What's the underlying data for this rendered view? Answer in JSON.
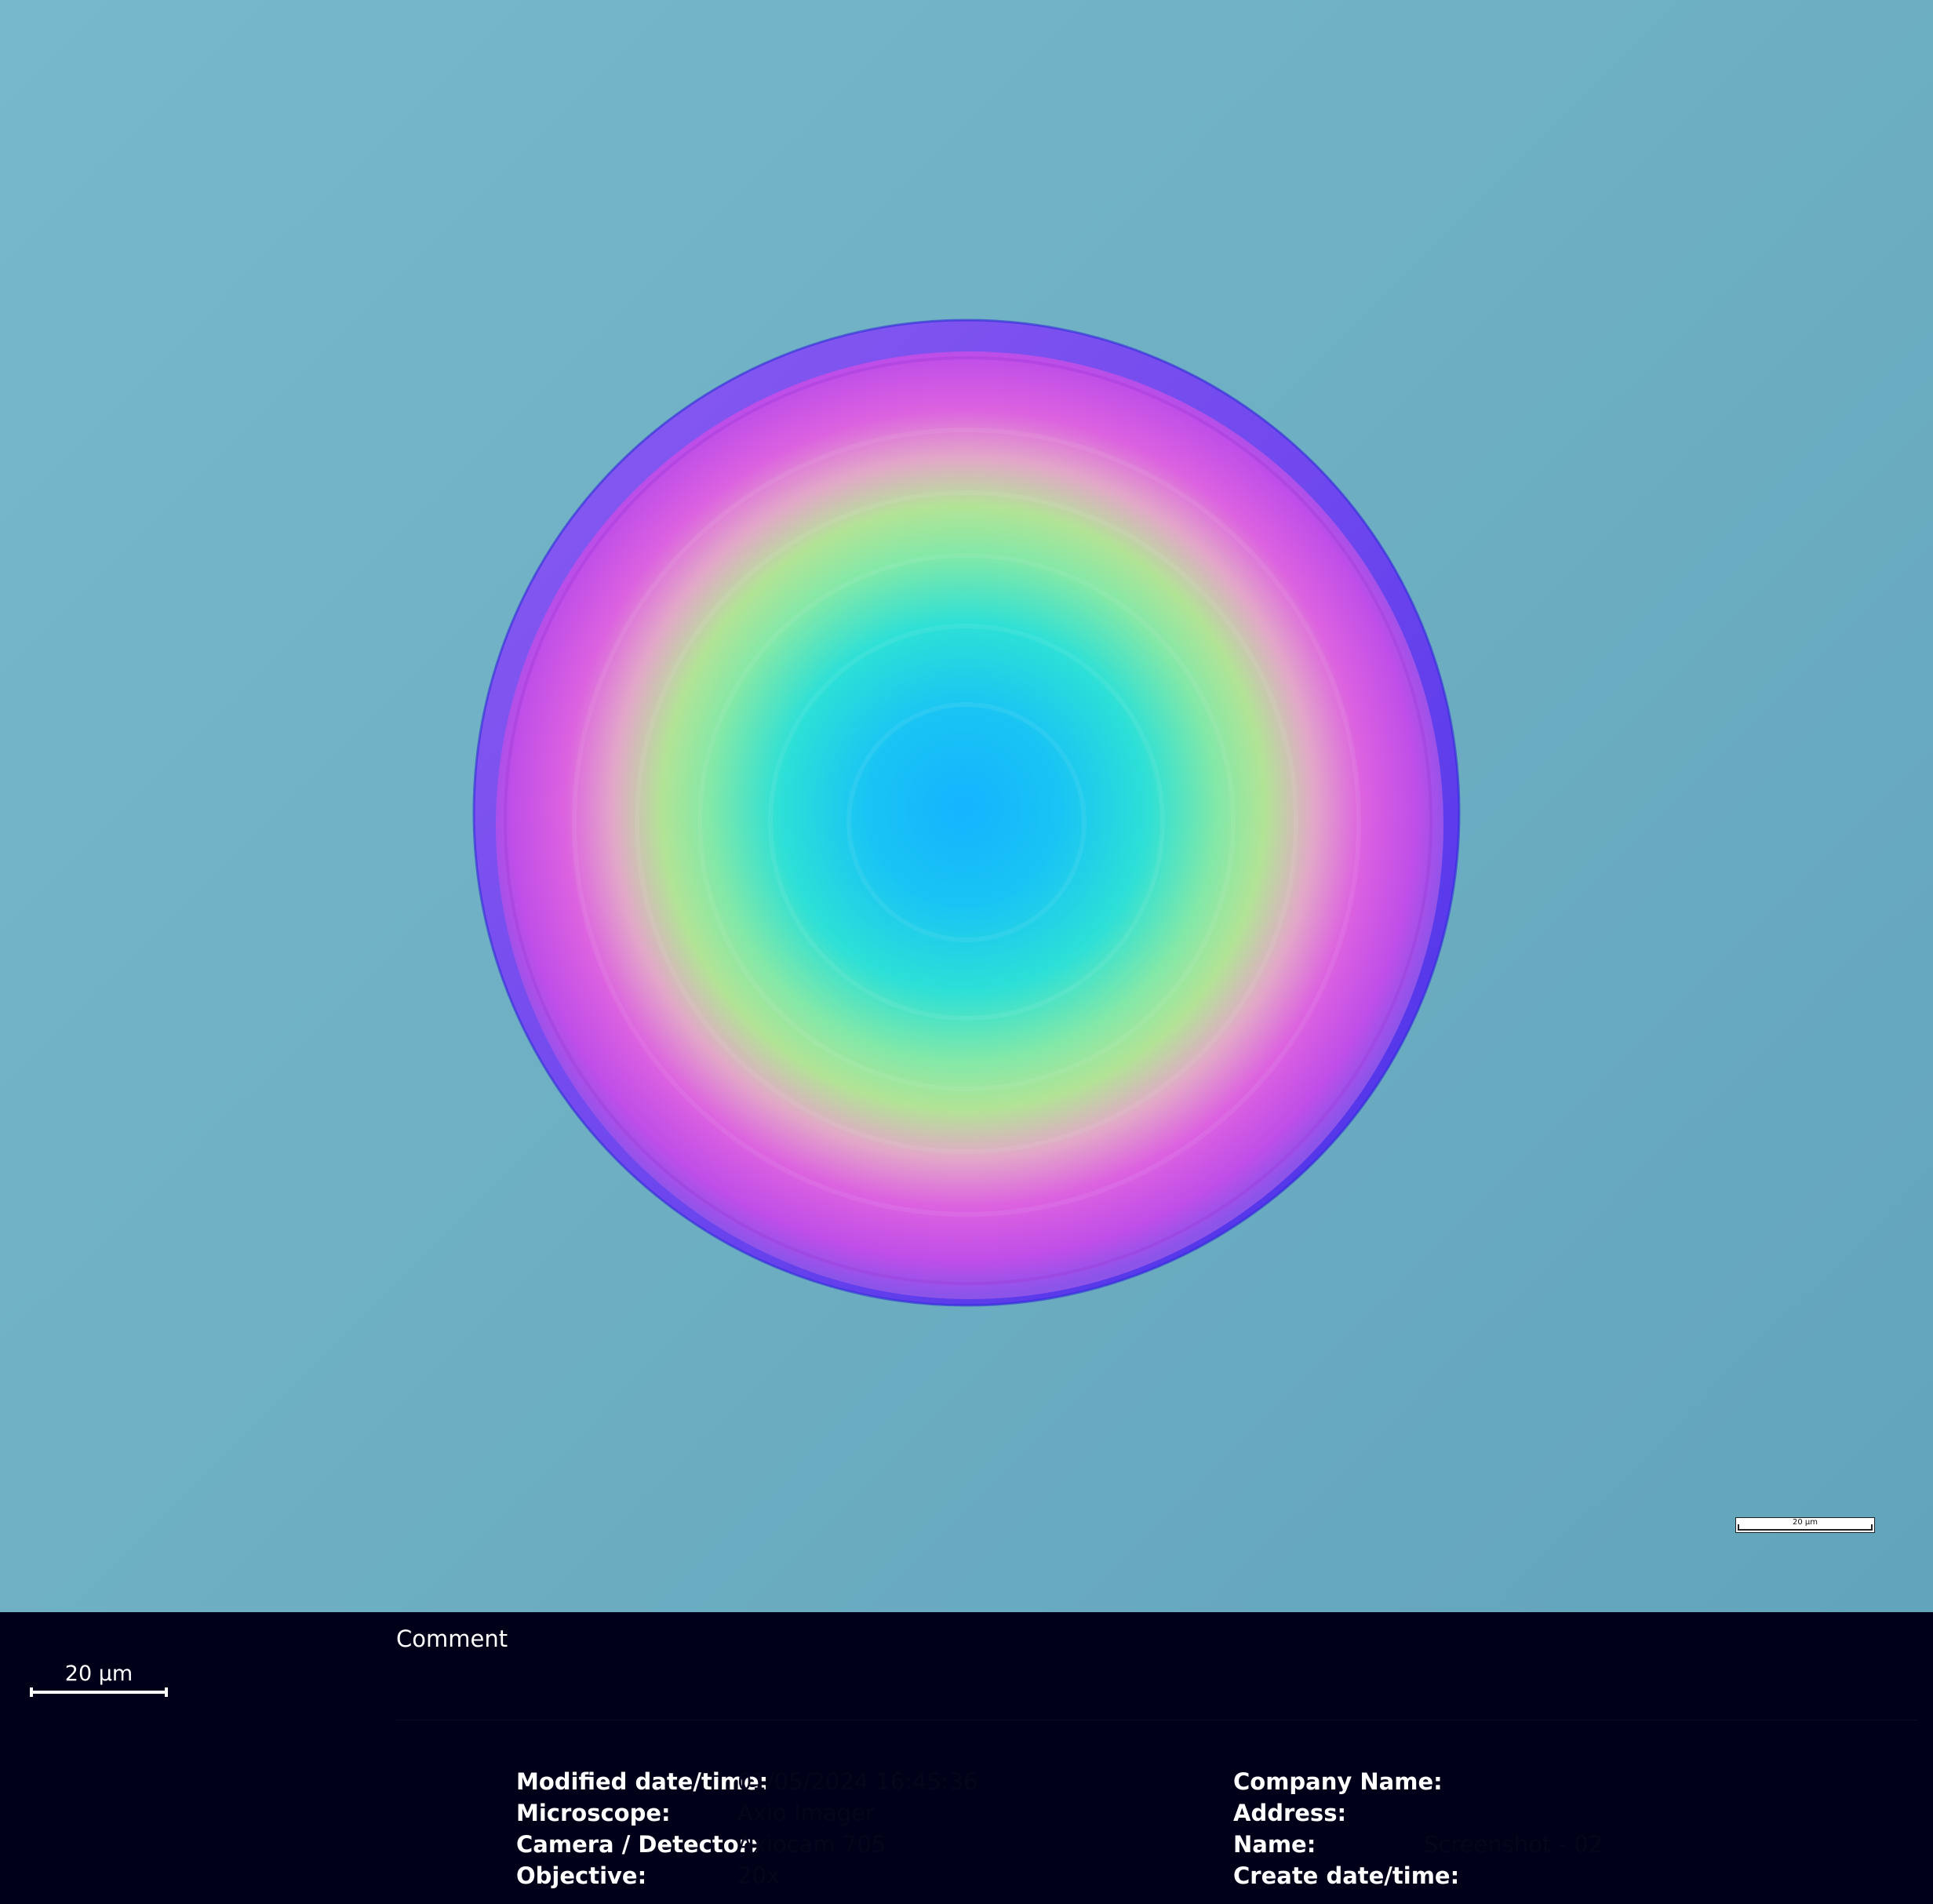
{
  "image": {
    "subject": "interference-colour-dome",
    "colors": {
      "background": "#6fb0c4",
      "center": "#14b4ff",
      "mid": "#8ee8a0",
      "outer": "#c055e8",
      "rim": "#6e4ff0"
    }
  },
  "inset_scalebar": {
    "label": "20 µm"
  },
  "info_panel": {
    "scalebar_label": "20 µm",
    "comment_label": "Comment",
    "left_fields": [
      {
        "label": "Modified date/time:",
        "value": "01/05/2024 16:45:36"
      },
      {
        "label": "Microscope:",
        "value": "Axio Imager"
      },
      {
        "label": "Camera / Detector:",
        "value": "Axiocam 705"
      },
      {
        "label": "Objective:",
        "value": "20x"
      }
    ],
    "right_fields": [
      {
        "label": "Company Name:",
        "value": ""
      },
      {
        "label": "Address:",
        "value": ""
      },
      {
        "label": "Name:",
        "value": "Screenshot - 02"
      },
      {
        "label": "Create date/time:",
        "value": ""
      }
    ]
  }
}
